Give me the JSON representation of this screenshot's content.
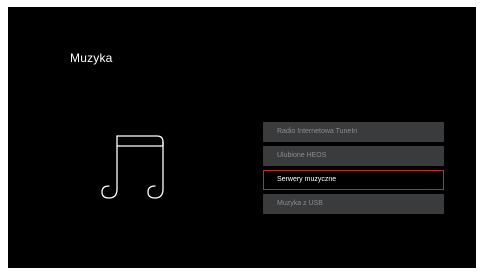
{
  "title": "Muzyka",
  "icon": "music-note-icon",
  "colors": {
    "background": "#000000",
    "menu_item": "#3a3b3d",
    "menu_text": "#8c8d8f",
    "selected_border": "#c4262e",
    "selected_text": "#ffffff"
  },
  "menu": {
    "selected_index": 2,
    "items": [
      {
        "label": "Radio Internetowa TuneIn"
      },
      {
        "label": "Ulubione HEOS"
      },
      {
        "label": "Serwery muzyczne"
      },
      {
        "label": "Muzyka z USB"
      }
    ]
  }
}
